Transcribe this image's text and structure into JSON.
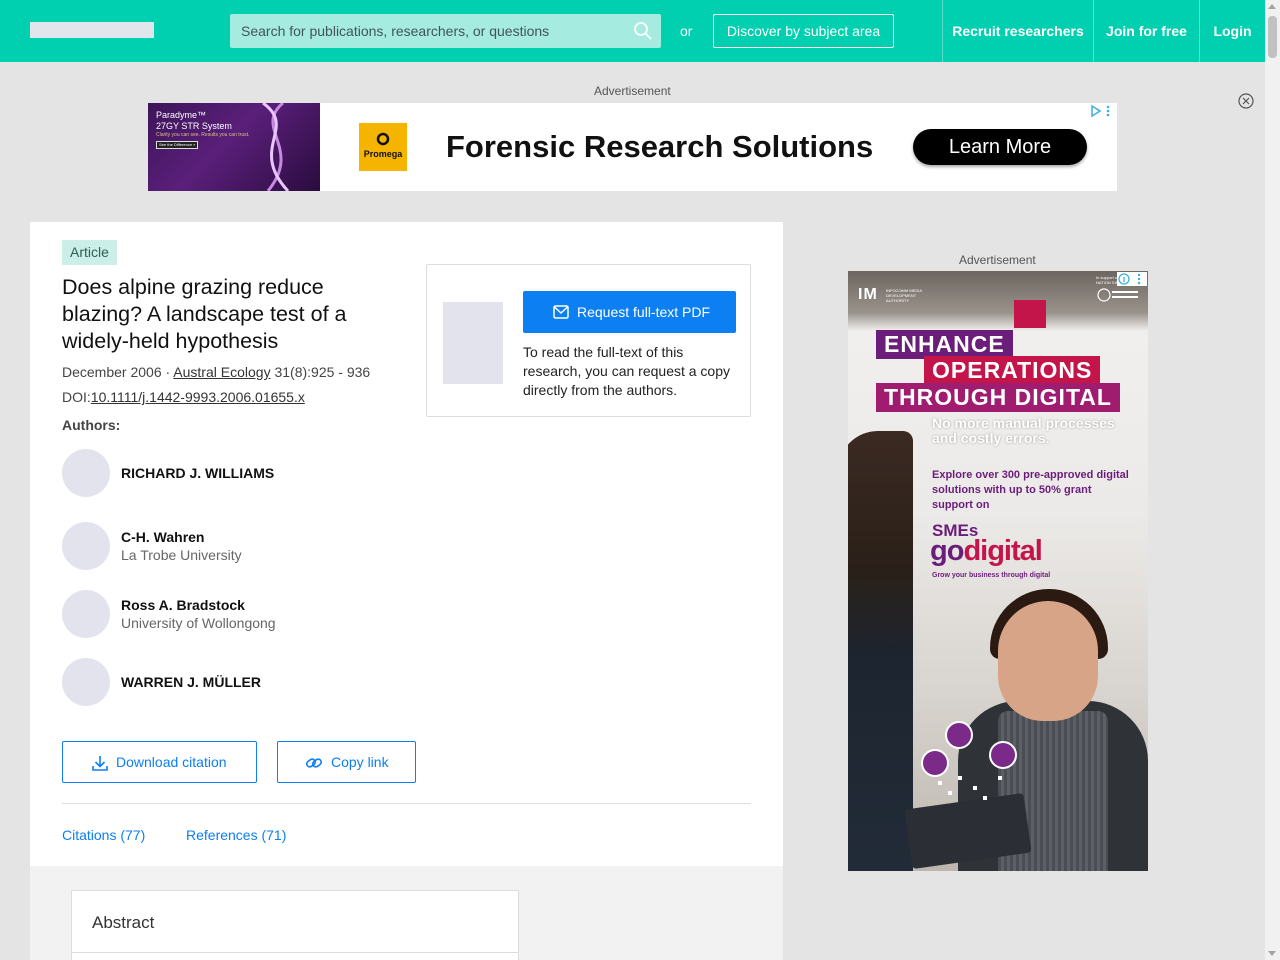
{
  "header": {
    "search_placeholder": "Search for publications, researchers, or questions",
    "or_label": "or",
    "discover_label": "Discover by subject area",
    "nav": [
      {
        "label": "Recruit researchers"
      },
      {
        "label": "Join for free"
      },
      {
        "label": "Login"
      }
    ],
    "brand_color": "#00d0af"
  },
  "ads": {
    "label_top": "Advertisement",
    "label_side": "Advertisement",
    "banner": {
      "thumb_line1": "Paradyme™",
      "thumb_line2": "27GY STR System",
      "thumb_line3": "Clarity you can see. Results you can trust.",
      "thumb_cta": "See the Difference »",
      "brand": "Promega",
      "headline": "Forensic Research Solutions",
      "cta": "Learn More"
    },
    "side": {
      "logo": "IM",
      "logo_sub": "INFOCOMM MEDIA DEVELOPMENT AUTHORITY",
      "partner_text": "In support of SMART NATION SINGAPORE",
      "headline_lines": [
        "ENHANCE",
        "OPERATIONS",
        "THROUGH DIGITAL"
      ],
      "subhead": "No more manual processes and costly errors.",
      "explore": "Explore over 300 pre-approved digital solutions with up to 50% grant support on",
      "smes": "SMEs",
      "go": "go",
      "digital": "digital",
      "tagline": "Grow your business through digital"
    }
  },
  "article": {
    "type_badge": "Article",
    "title": "Does alpine grazing reduce blazing? A landscape test of a widely-held hypothesis",
    "date": "December 2006 · ",
    "journal": "Austral Ecology",
    "volume_pages": " 31(8):925 - 936",
    "doi_prefix": "DOI:",
    "doi": "10.1111/j.1442-9993.2006.01655.x",
    "authors_label": "Authors:",
    "authors": [
      {
        "name": "RICHARD J. WILLIAMS",
        "institution": ""
      },
      {
        "name": "C-H. Wahren",
        "institution": "La Trobe University"
      },
      {
        "name": "Ross A. Bradstock",
        "institution": "University of Wollongong"
      },
      {
        "name": "WARREN J. MÜLLER",
        "institution": ""
      }
    ],
    "request_pdf_label": "Request full-text PDF",
    "request_note": "To read the full-text of this research, you can request a copy directly from the authors.",
    "download_citation_label": "Download citation",
    "copy_link_label": "Copy link",
    "tabs": [
      {
        "label": "Citations (77)"
      },
      {
        "label": "References (71)"
      }
    ],
    "abstract_label": "Abstract",
    "accent_color": "#0c7ff2"
  }
}
